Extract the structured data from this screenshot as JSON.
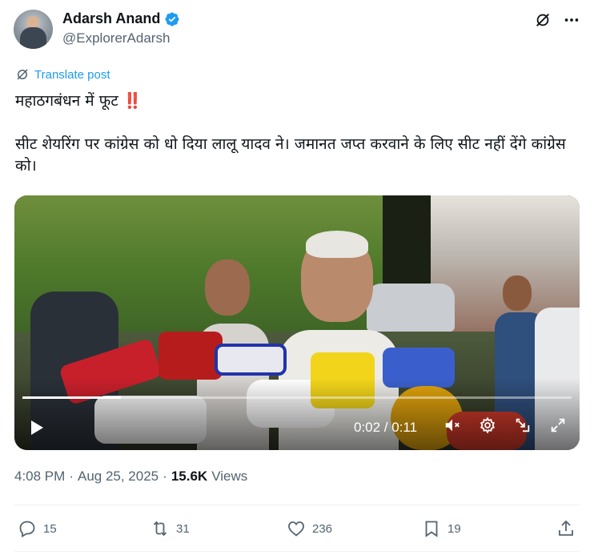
{
  "author": {
    "display_name": "Adarsh Anand",
    "handle": "@ExplorerAdarsh",
    "verified": true
  },
  "header_icons": [
    "grok-icon",
    "more-icon"
  ],
  "translate_label": "Translate post",
  "tweet": {
    "line1": "महाठगबंधन में फूट ",
    "line1_emoji": "‼️",
    "line2": "सीट शेयरिंग पर कांग्रेस को धो दिया लालू यादव ने। जमानत जप्त करवाने के लिए सीट नहीं देंगे कांग्रेस को।"
  },
  "video": {
    "time_display": "0:02 / 0:11",
    "progress": 0.18,
    "controls": [
      "play-icon",
      "mute-icon",
      "settings-icon",
      "pip-icon",
      "fullscreen-icon"
    ]
  },
  "meta": {
    "time": "4:08 PM",
    "sep1": "·",
    "date": "Aug 25, 2025",
    "sep2": "·",
    "views_count": "15.6K",
    "views_label": "Views"
  },
  "actions": {
    "replies": "15",
    "reposts": "31",
    "likes": "236",
    "bookmarks": "19"
  },
  "colors": {
    "accent": "#1d9bf0",
    "text": "#0f1419",
    "muted": "#536471"
  }
}
